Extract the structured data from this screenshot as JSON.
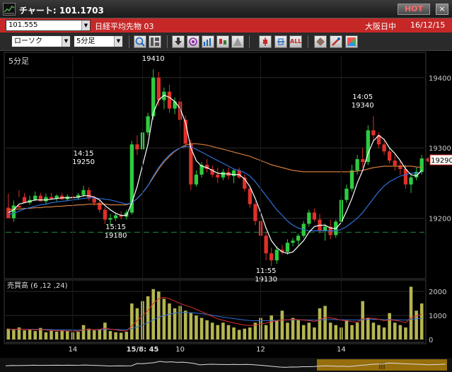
{
  "window": {
    "title": "チャート: 101.1703",
    "hot_label": "HOT",
    "close_label": "×"
  },
  "symbol_bar": {
    "code": "101.555",
    "instrument": "日経平均先物 03",
    "market": "大阪日中",
    "date": "16/12/15"
  },
  "toolbar": {
    "chart_type": "ローソク",
    "interval": "5分足",
    "icons": [
      "zoom-icon",
      "layout-icon",
      "download-icon",
      "search-chart-icon",
      "indicator-icon",
      "compare-icon",
      "alert-icon",
      "line-icon",
      "band-icon",
      "all-icon",
      "pattern-icon",
      "tools-icon",
      "color-icon"
    ],
    "all_label": "ALL"
  },
  "colors": {
    "up": "#2ecc40",
    "down": "#e0302a",
    "ma_short": "#ffffff",
    "ma_mid": "#2f6fd8",
    "ma_long": "#d07a3a",
    "volume": "#b5b550",
    "grid": "#2a2a2a",
    "dash": "#1e8a3a",
    "tag_bg": "#ffffff"
  },
  "chart_data": {
    "type": "candlestick",
    "main_label": "5分足",
    "y_ticks": [
      19200,
      19300,
      19400
    ],
    "y_range": [
      19120,
      19430
    ],
    "current_price_label": "19290",
    "annotations": [
      {
        "time": "14:15",
        "price": "19250"
      },
      {
        "time": "15:15",
        "price": "19180"
      },
      {
        "time": "",
        "price": "19410"
      },
      {
        "time": "14:05",
        "price": "19340"
      },
      {
        "time": "11:55",
        "price": "19130"
      }
    ],
    "x_ticks": [
      "14",
      "15/8: 45",
      "10",
      "12",
      "14"
    ],
    "candles": [
      [
        19215,
        19235,
        19205,
        19200
      ],
      [
        19200,
        19225,
        19195,
        19218
      ],
      [
        19218,
        19240,
        19230,
        19215
      ],
      [
        19230,
        19236,
        19225,
        19222
      ],
      [
        19222,
        19232,
        19219,
        19226
      ],
      [
        19226,
        19238,
        19224,
        19232
      ],
      [
        19232,
        19236,
        19225,
        19224
      ],
      [
        19224,
        19235,
        19220,
        19230
      ],
      [
        19230,
        19236,
        19226,
        19228
      ],
      [
        19228,
        19234,
        19224,
        19232
      ],
      [
        19232,
        19236,
        19226,
        19227
      ],
      [
        19227,
        19234,
        19224,
        19231
      ],
      [
        19231,
        19236,
        19228,
        19229
      ],
      [
        19229,
        19236,
        19226,
        19233
      ],
      [
        19233,
        19246,
        19230,
        19240
      ],
      [
        19240,
        19244,
        19225,
        19228
      ],
      [
        19228,
        19232,
        19218,
        19222
      ],
      [
        19222,
        19226,
        19208,
        19212
      ],
      [
        19212,
        19216,
        19192,
        19198
      ],
      [
        19198,
        19206,
        19190,
        19200
      ],
      [
        19200,
        19208,
        19196,
        19204
      ],
      [
        19204,
        19210,
        19198,
        19202
      ],
      [
        19202,
        19212,
        19198,
        19208
      ],
      [
        19208,
        19310,
        19205,
        19305
      ],
      [
        19305,
        19318,
        19290,
        19298
      ],
      [
        19298,
        19328,
        19295,
        19322
      ],
      [
        19322,
        19350,
        19318,
        19345
      ],
      [
        19345,
        19412,
        19340,
        19400
      ],
      [
        19400,
        19408,
        19360,
        19368
      ],
      [
        19368,
        19386,
        19355,
        19380
      ],
      [
        19380,
        19390,
        19350,
        19356
      ],
      [
        19356,
        19372,
        19348,
        19366
      ],
      [
        19366,
        19372,
        19330,
        19340
      ],
      [
        19340,
        19346,
        19300,
        19306
      ],
      [
        19306,
        19312,
        19240,
        19248
      ],
      [
        19248,
        19268,
        19245,
        19262
      ],
      [
        19262,
        19280,
        19258,
        19276
      ],
      [
        19276,
        19284,
        19265,
        19270
      ],
      [
        19270,
        19275,
        19258,
        19262
      ],
      [
        19262,
        19272,
        19250,
        19258
      ],
      [
        19258,
        19270,
        19254,
        19266
      ],
      [
        19266,
        19272,
        19255,
        19260
      ],
      [
        19260,
        19270,
        19250,
        19268
      ],
      [
        19268,
        19272,
        19256,
        19258
      ],
      [
        19258,
        19262,
        19238,
        19242
      ],
      [
        19242,
        19246,
        19215,
        19220
      ],
      [
        19220,
        19224,
        19190,
        19196
      ],
      [
        19196,
        19200,
        19170,
        19175
      ],
      [
        19175,
        19180,
        19140,
        19150
      ],
      [
        19150,
        19158,
        19132,
        19140
      ],
      [
        19140,
        19160,
        19135,
        19155
      ],
      [
        19155,
        19162,
        19148,
        19152
      ],
      [
        19152,
        19170,
        19148,
        19165
      ],
      [
        19165,
        19172,
        19160,
        19168
      ],
      [
        19168,
        19178,
        19162,
        19175
      ],
      [
        19175,
        19196,
        19172,
        19192
      ],
      [
        19192,
        19212,
        19188,
        19208
      ],
      [
        19208,
        19214,
        19195,
        19198
      ],
      [
        19198,
        19206,
        19178,
        19182
      ],
      [
        19182,
        19192,
        19168,
        19188
      ],
      [
        19188,
        19198,
        19170,
        19176
      ],
      [
        19176,
        19198,
        19172,
        19195
      ],
      [
        19195,
        19232,
        19192,
        19226
      ],
      [
        19226,
        19248,
        19222,
        19242
      ],
      [
        19242,
        19276,
        19238,
        19268
      ],
      [
        19268,
        19290,
        19262,
        19284
      ],
      [
        19284,
        19300,
        19272,
        19280
      ],
      [
        19280,
        19332,
        19276,
        19325
      ],
      [
        19325,
        19345,
        19310,
        19318
      ],
      [
        19318,
        19322,
        19300,
        19305
      ],
      [
        19305,
        19310,
        19290,
        19295
      ],
      [
        19295,
        19300,
        19278,
        19282
      ],
      [
        19282,
        19290,
        19268,
        19275
      ],
      [
        19275,
        19282,
        19262,
        19270
      ],
      [
        19270,
        19276,
        19242,
        19248
      ],
      [
        19248,
        19262,
        19236,
        19258
      ],
      [
        19258,
        19272,
        19254,
        19266
      ],
      [
        19266,
        19290,
        19262,
        19285
      ]
    ],
    "ma_short": [
      19208,
      19212,
      19220,
      19222,
      19224,
      19226,
      19226,
      19226,
      19227,
      19228,
      19229,
      19229,
      19229,
      19230,
      19232,
      19232,
      19230,
      19226,
      19218,
      19212,
      19207,
      19204,
      19204,
      19222,
      19245,
      19275,
      19305,
      19350,
      19368,
      19375,
      19372,
      19366,
      19356,
      19336,
      19300,
      19282,
      19274,
      19272,
      19268,
      19264,
      19263,
      19263,
      19262,
      19262,
      19256,
      19245,
      19228,
      19208,
      19186,
      19168,
      19158,
      19152,
      19150,
      19152,
      19160,
      19168,
      19180,
      19188,
      19190,
      19190,
      19186,
      19185,
      19194,
      19210,
      19228,
      19250,
      19268,
      19292,
      19310,
      19318,
      19312,
      19300,
      19292,
      19282,
      19270,
      19262,
      19260,
      19268
    ],
    "ma_mid": [
      19205,
      19207,
      19210,
      19213,
      19215,
      19217,
      19219,
      19220,
      19222,
      19223,
      19224,
      19225,
      19226,
      19227,
      19228,
      19229,
      19229,
      19228,
      19227,
      19226,
      19224,
      19222,
      19220,
      19222,
      19228,
      19236,
      19246,
      19260,
      19272,
      19282,
      19290,
      19296,
      19300,
      19302,
      19302,
      19298,
      19294,
      19290,
      19286,
      19282,
      19278,
      19274,
      19270,
      19268,
      19265,
      19260,
      19252,
      19242,
      19232,
      19222,
      19212,
      19204,
      19196,
      19190,
      19186,
      19184,
      19182,
      19182,
      19182,
      19182,
      19182,
      19182,
      19184,
      19188,
      19194,
      19200,
      19208,
      19218,
      19228,
      19238,
      19246,
      19252,
      19256,
      19260,
      19262,
      19264,
      19264,
      19266
    ],
    "ma_long": [
      19212,
      19213,
      19213,
      19214,
      19214,
      19215,
      19215,
      19216,
      19216,
      19217,
      19217,
      19218,
      19218,
      19219,
      19219,
      19220,
      19220,
      19220,
      19220,
      19219,
      19219,
      19219,
      19219,
      19222,
      19228,
      19236,
      19246,
      19258,
      19270,
      19280,
      19288,
      19295,
      19300,
      19304,
      19306,
      19306,
      19305,
      19304,
      19302,
      19300,
      19298,
      19296,
      19294,
      19292,
      19290,
      19288,
      19285,
      19282,
      19279,
      19276,
      19274,
      19272,
      19270,
      19268,
      19267,
      19266,
      19266,
      19266,
      19266,
      19266,
      19266,
      19266,
      19266,
      19266,
      19266,
      19267,
      19268,
      19270,
      19272,
      19273,
      19274,
      19274,
      19274,
      19274,
      19274,
      19274,
      19273,
      19272
    ],
    "volume_label": "売買高 (6 ,12 ,24)",
    "volume_ticks": [
      0,
      1000,
      2000
    ],
    "volume": [
      450,
      400,
      500,
      380,
      420,
      350,
      480,
      300,
      360,
      330,
      380,
      350,
      300,
      320,
      600,
      450,
      380,
      400,
      700,
      350,
      300,
      280,
      320,
      1500,
      1300,
      1600,
      1800,
      2100,
      2000,
      1700,
      1500,
      1300,
      1400,
      1200,
      1100,
      1000,
      900,
      800,
      700,
      600,
      700,
      600,
      500,
      400,
      450,
      500,
      700,
      900,
      600,
      1000,
      800,
      1200,
      700,
      900,
      800,
      600,
      700,
      500,
      1300,
      1400,
      700,
      600,
      500,
      800,
      600,
      700,
      1600,
      900,
      700,
      600,
      500,
      1100,
      700,
      600,
      500,
      2200,
      1200,
      1500
    ],
    "volume_ma_short": [
      430,
      420,
      440,
      420,
      410,
      400,
      420,
      390,
      380,
      370,
      360,
      355,
      350,
      345,
      400,
      420,
      410,
      420,
      470,
      430,
      400,
      370,
      350,
      580,
      780,
      980,
      1200,
      1500,
      1700,
      1760,
      1700,
      1600,
      1500,
      1420,
      1350,
      1260,
      1160,
      1060,
      960,
      860,
      800,
      740,
      690,
      640,
      600,
      580,
      600,
      640,
      680,
      740,
      780,
      820,
      820,
      840,
      830,
      810,
      790,
      750,
      820,
      920,
      900,
      860,
      800,
      780,
      740,
      720,
      860,
      900,
      880,
      840,
      780,
      820,
      800,
      760,
      700,
      900,
      980,
      1060
    ],
    "volume_ma_long": [
      420,
      420,
      425,
      425,
      422,
      420,
      420,
      415,
      410,
      405,
      400,
      398,
      395,
      392,
      400,
      405,
      405,
      408,
      420,
      420,
      415,
      410,
      405,
      450,
      520,
      600,
      700,
      820,
      920,
      1000,
      1060,
      1100,
      1120,
      1130,
      1120,
      1100,
      1080,
      1050,
      1010,
      970,
      930,
      900,
      870,
      840,
      810,
      790,
      780,
      780,
      780,
      790,
      800,
      810,
      815,
      820,
      820,
      818,
      815,
      810,
      815,
      825,
      830,
      830,
      825,
      820,
      815,
      810,
      825,
      835,
      840,
      838,
      830,
      828,
      824,
      818,
      810,
      840,
      860,
      880
    ]
  }
}
